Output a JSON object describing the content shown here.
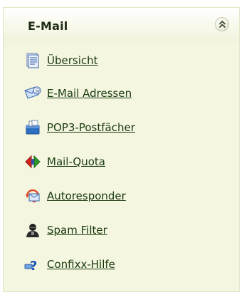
{
  "panel": {
    "title": "E-Mail",
    "collapse_icon": "double-chevron-up-icon"
  },
  "menu": {
    "items": [
      {
        "label": "Übersicht",
        "icon": "document-icon"
      },
      {
        "label": "E-Mail Adressen",
        "icon": "email-address-icon"
      },
      {
        "label": "POP3-Postfächer",
        "icon": "mailbox-icon"
      },
      {
        "label": "Mail-Quota",
        "icon": "quota-icon"
      },
      {
        "label": "Autoresponder",
        "icon": "autoresponder-icon"
      },
      {
        "label": "Spam Filter",
        "icon": "spam-filter-icon"
      },
      {
        "label": "Confixx-Hilfe",
        "icon": "help-icon"
      }
    ]
  }
}
